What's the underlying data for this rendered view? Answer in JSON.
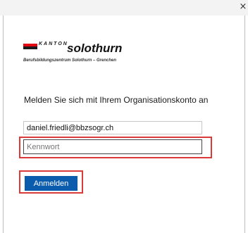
{
  "window": {
    "close_icon": "×"
  },
  "logo": {
    "kanton": "KANTON",
    "city": "solothurn",
    "subtitle": "Berufsbildungszentrum Solothurn – Grenchen"
  },
  "form": {
    "heading": "Melden Sie sich mit Ihrem Organisationskonto an",
    "email_value": "daniel.friedli@bbzsogr.ch",
    "password_placeholder": "Kennwort",
    "submit_label": "Anmelden"
  },
  "colors": {
    "primary_button": "#0b5cad",
    "highlight_outline": "#d93a3a",
    "brand_red": "#e30613"
  }
}
